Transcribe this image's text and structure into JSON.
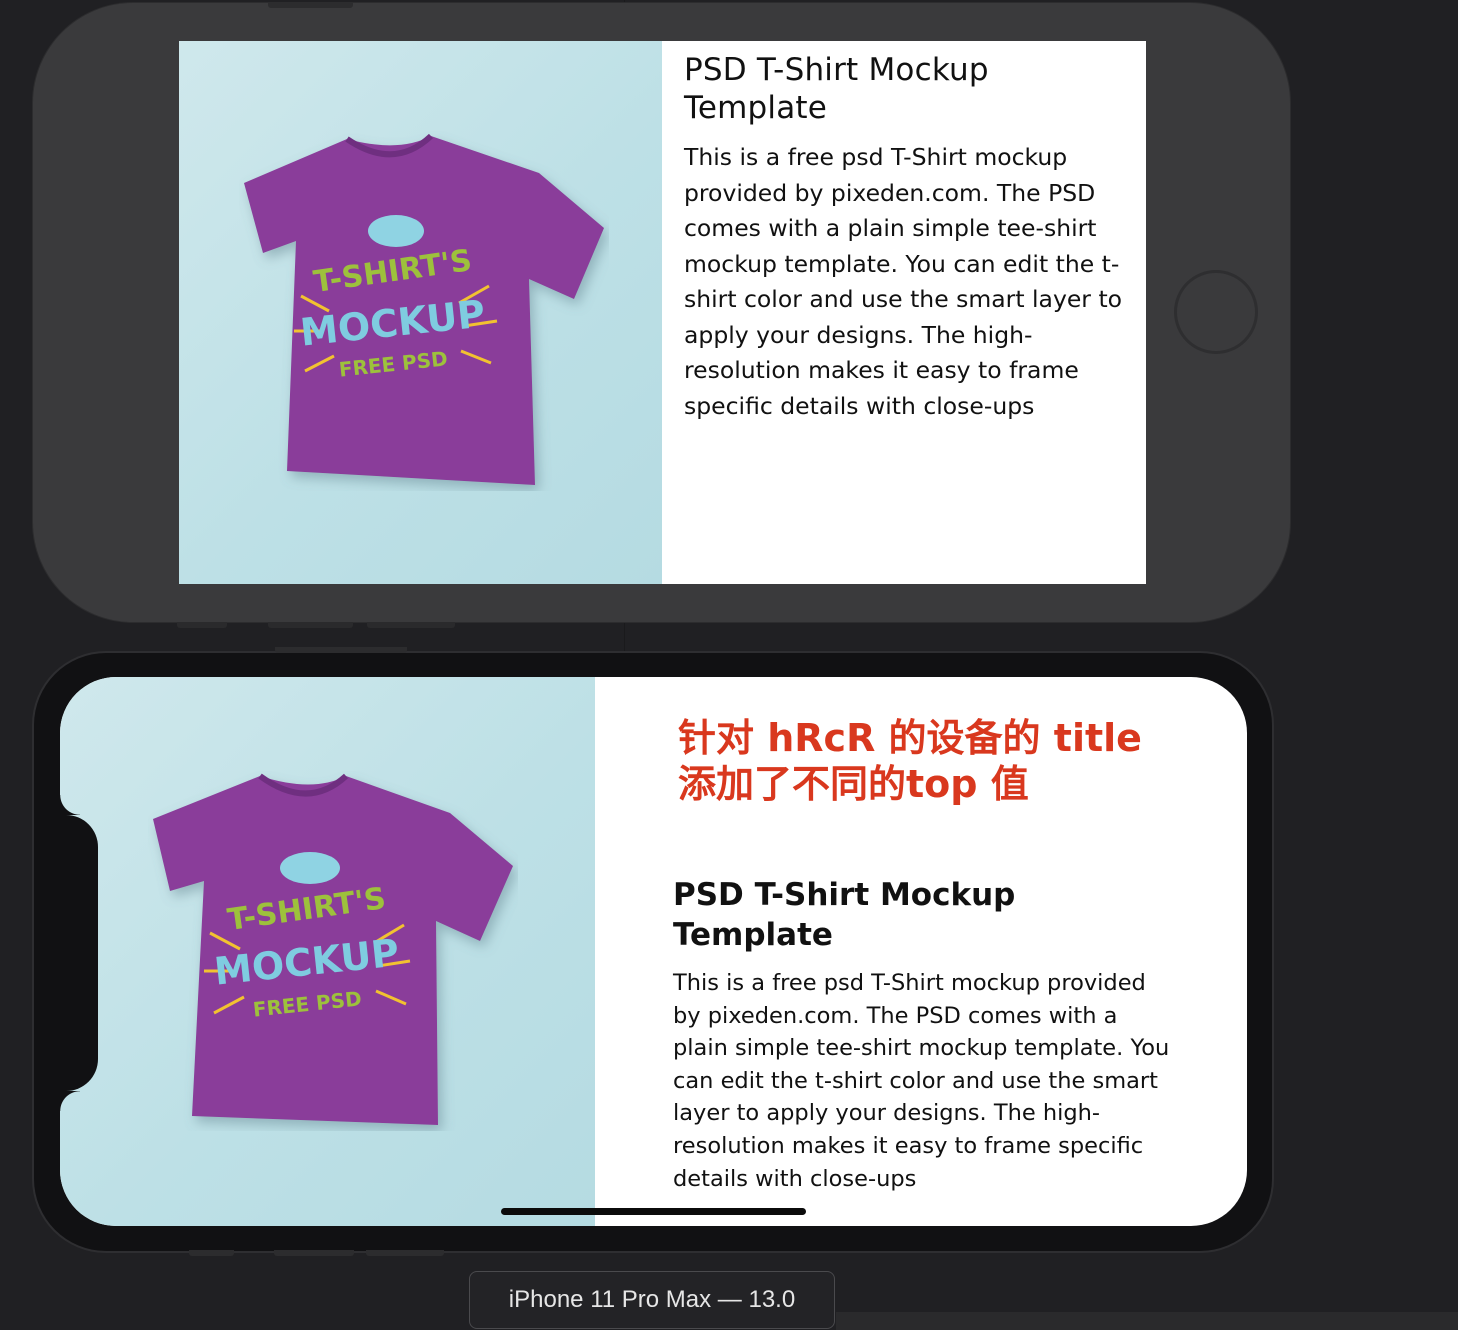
{
  "card": {
    "title": "PSD T-Shirt Mockup Template",
    "description": "This is a free psd T-Shirt mockup provided by pixeden.com. The PSD comes with a plain simple tee-shirt mockup template. You can edit the t-shirt color and use the smart layer to apply your designs. The high-resolution makes it easy to frame specific details with close-ups",
    "image_alt": "T-Shirt mockup",
    "shirt_text": {
      "line1": "T-SHIRT'S",
      "line2": "MOCKUP",
      "line3": "FREE PSD"
    }
  },
  "annotation": {
    "line1": "针对 hRcR 的设备的 title",
    "line2": "添加了不同的top 值"
  },
  "device_label": "iPhone 11 Pro Max — 13.0",
  "colors": {
    "background": "#202023",
    "annotation": "#d9381e",
    "shirt": "#8a3e9a",
    "image_bg": "#c2e2e8"
  }
}
